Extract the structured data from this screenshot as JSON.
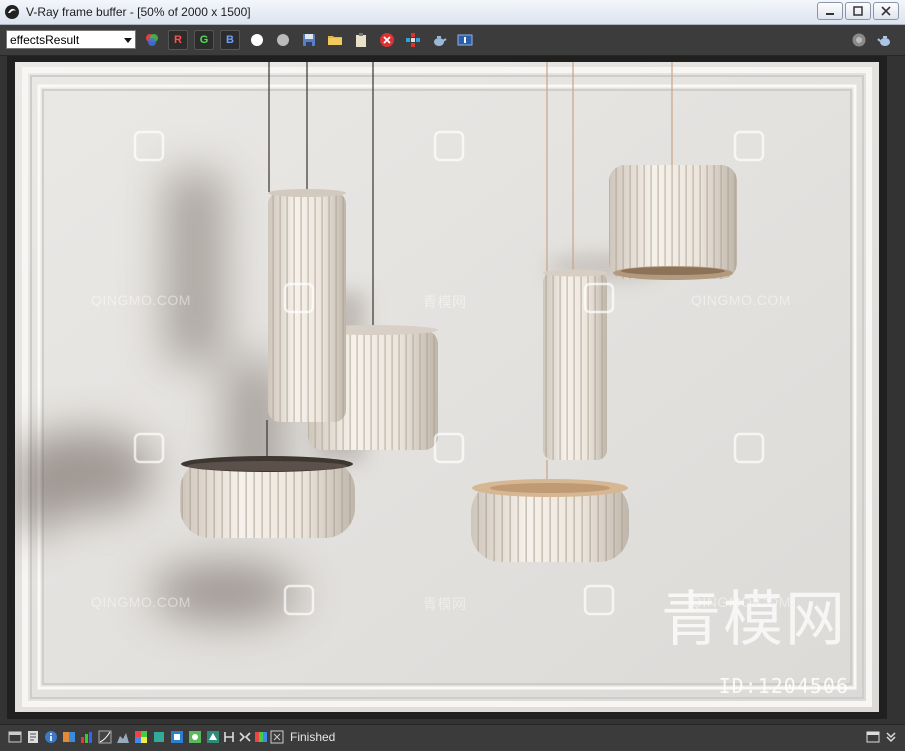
{
  "window": {
    "title": "V-Ray frame buffer - [50% of 2000 x 1500]"
  },
  "toolbar": {
    "channel_value": "effectsResult",
    "r_label": "R",
    "g_label": "G",
    "b_label": "B"
  },
  "status": {
    "text": "Finished"
  },
  "overlay": {
    "watermark_latin": "QINGMO.COM",
    "watermark_cn": "青模网",
    "brand_cn": "青模网",
    "id_text": "ID:1204506"
  },
  "colors": {
    "wall": "#e6e4e1",
    "lamp": "#efe9e2",
    "toolbar": "#3c3c3c"
  }
}
